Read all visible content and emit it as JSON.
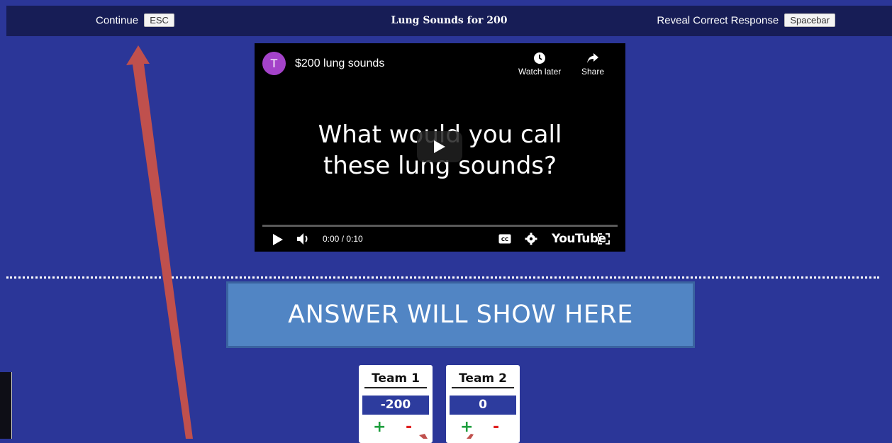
{
  "topbar": {
    "continue_label": "Continue",
    "continue_key": "ESC",
    "title": "Lung Sounds for 200",
    "reveal_label": "Reveal Correct Response",
    "reveal_key": "Spacebar"
  },
  "video": {
    "channel_initial": "T",
    "title": "$200 lung sounds",
    "watch_later_label": "Watch later",
    "share_label": "Share",
    "question_line1": "What would you call",
    "question_line2": "these lung sounds?",
    "time": "0:00 / 0:10",
    "brand": "YouTube"
  },
  "answer": {
    "text": "ANSWER WILL SHOW HERE"
  },
  "teams": [
    {
      "name": "Team 1",
      "score": "-200",
      "plus": "+",
      "minus": "-"
    },
    {
      "name": "Team 2",
      "score": "0",
      "plus": "+",
      "minus": "-"
    }
  ],
  "colors": {
    "background": "#2b3698",
    "topbar": "#171d56",
    "answer_box": "#5185c4",
    "arrow": "#c0504d"
  },
  "icons": [
    "clock-icon",
    "share-icon",
    "play-icon",
    "volume-icon",
    "captions-icon",
    "settings-gear-icon",
    "fullscreen-icon"
  ]
}
